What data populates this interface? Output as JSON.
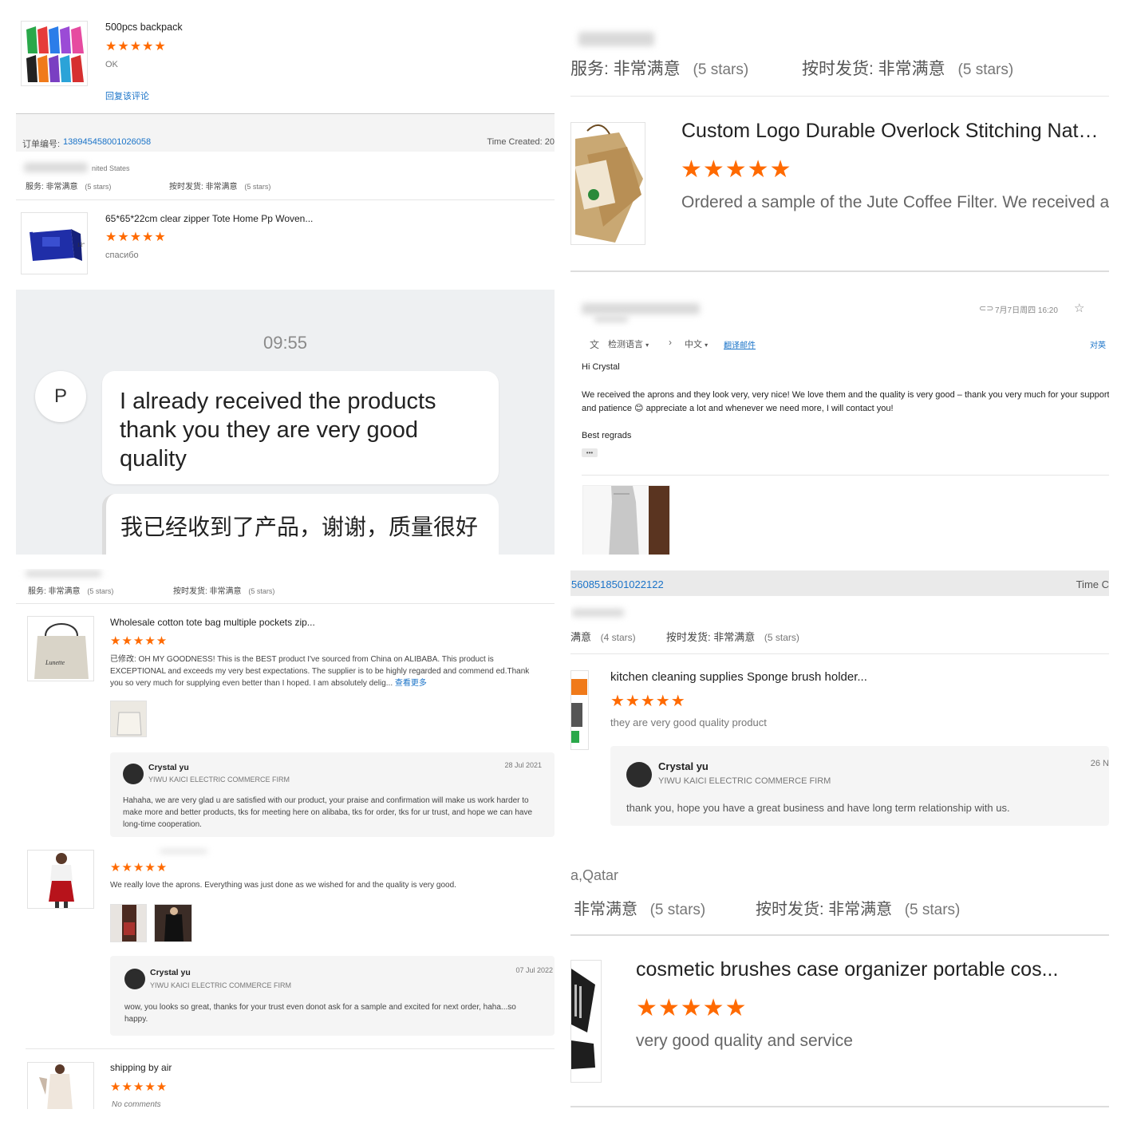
{
  "p1": {
    "r1": {
      "title": "500pcs backpack",
      "stars": "★★★★★",
      "comment": "OK",
      "reply_link": "回复该评论"
    },
    "order": {
      "label": "订单编号:",
      "number": "138945458001026058",
      "time": "Time Created: 20",
      "country": "nited States",
      "service": "服务: 非常满意",
      "service_stars": "(5 stars)",
      "ship": "按时发货: 非常满意",
      "ship_stars": "(5 stars)"
    },
    "r2": {
      "title": "65*65*22cm clear zipper Tote Home Pp Woven...",
      "stars": "★★★★★",
      "comment": "спасибо"
    }
  },
  "p2": {
    "service": "服务: 非常满意",
    "service_stars": "(5 stars)",
    "ship": "按时发货: 非常满意",
    "ship_stars": "(5 stars)",
    "title": "Custom Logo Durable Overlock Stitching Natur...",
    "stars": "★★★★★",
    "comment": "Ordered a sample of the Jute Coffee Filter. We received a"
  },
  "p3": {
    "time": "09:55",
    "avatar": "P",
    "msg1": "I already received the products thank you they are very good quality",
    "msg2": "我已经收到了产品，谢谢，质量很好"
  },
  "p4": {
    "date": "7月7日周四 16:20",
    "detect_lang": "检测语言",
    "lang": "中文",
    "translate": "翻译邮件",
    "compare": "对英",
    "greeting": "Hi Crystal",
    "body": "We received the aprons and they look very, very nice! We love them and the quality is very good – thank you very much for your support and patience 😊 appreciate a lot and whenever we need more, I will contact you!",
    "signoff": "Best regrads",
    "dots": "•••"
  },
  "p5": {
    "service": "服务: 非常满意",
    "service_stars": "(5 stars)",
    "ship": "按时发货: 非常满意",
    "ship_stars": "(5 stars)",
    "r1": {
      "title": "Wholesale cotton tote bag multiple pockets zip...",
      "stars": "★★★★★",
      "comment": "已修改: OH MY GOODNESS! This is the BEST product I've sourced from China on ALIBABA. This product is EXCEPTIONAL and exceeds my very best expectations. The supplier is to be highly regarded and commend ed.Thank you so very much for supplying even better than I hoped. I am absolutely delig...",
      "more": "查看更多",
      "reply": {
        "name": "Crystal yu",
        "company": "YIWU KAICI ELECTRIC COMMERCE FIRM",
        "date": "28 Jul 2021",
        "text": "Hahaha, we are very glad u are satisfied with our product, your praise and confirmation will make us work harder to make more and better products, tks for meeting here on alibaba, tks for order, tks for ur trust, and hope we can have long-time cooperation."
      }
    },
    "r2": {
      "stars": "★★★★★",
      "comment": "We really love the aprons. Everything was just done as we wished for and the quality is very good.",
      "reply": {
        "name": "Crystal yu",
        "company": "YIWU KAICI ELECTRIC COMMERCE FIRM",
        "date": "07 Jul 2022",
        "text": "wow, you looks so great, thanks for your trust even donot ask for a sample and excited for next order, haha...so happy."
      }
    },
    "r3": {
      "title": "shipping by air",
      "stars": "★★★★★",
      "comment": "No comments"
    }
  },
  "p6": {
    "order": "5608518501022122",
    "time": "Time C",
    "service": "满意",
    "service_stars": "(4 stars)",
    "ship": "按时发货: 非常满意",
    "ship_stars": "(5 stars)",
    "title": "kitchen cleaning supplies Sponge brush holder...",
    "stars": "★★★★★",
    "comment": "they are very good quality product",
    "reply": {
      "name": "Crystal yu",
      "company": "YIWU KAICI ELECTRIC COMMERCE FIRM",
      "date": "26 N",
      "text": "thank you, hope you have a great business and have long term relationship with us."
    },
    "location": "a,Qatar",
    "service2": "非常满意",
    "service2_stars": "(5 stars)",
    "ship2": "按时发货: 非常满意",
    "ship2_stars": "(5 stars)",
    "title2": "cosmetic brushes case organizer portable cos...",
    "stars2": "★★★★★",
    "comment2": "very good quality and service"
  }
}
